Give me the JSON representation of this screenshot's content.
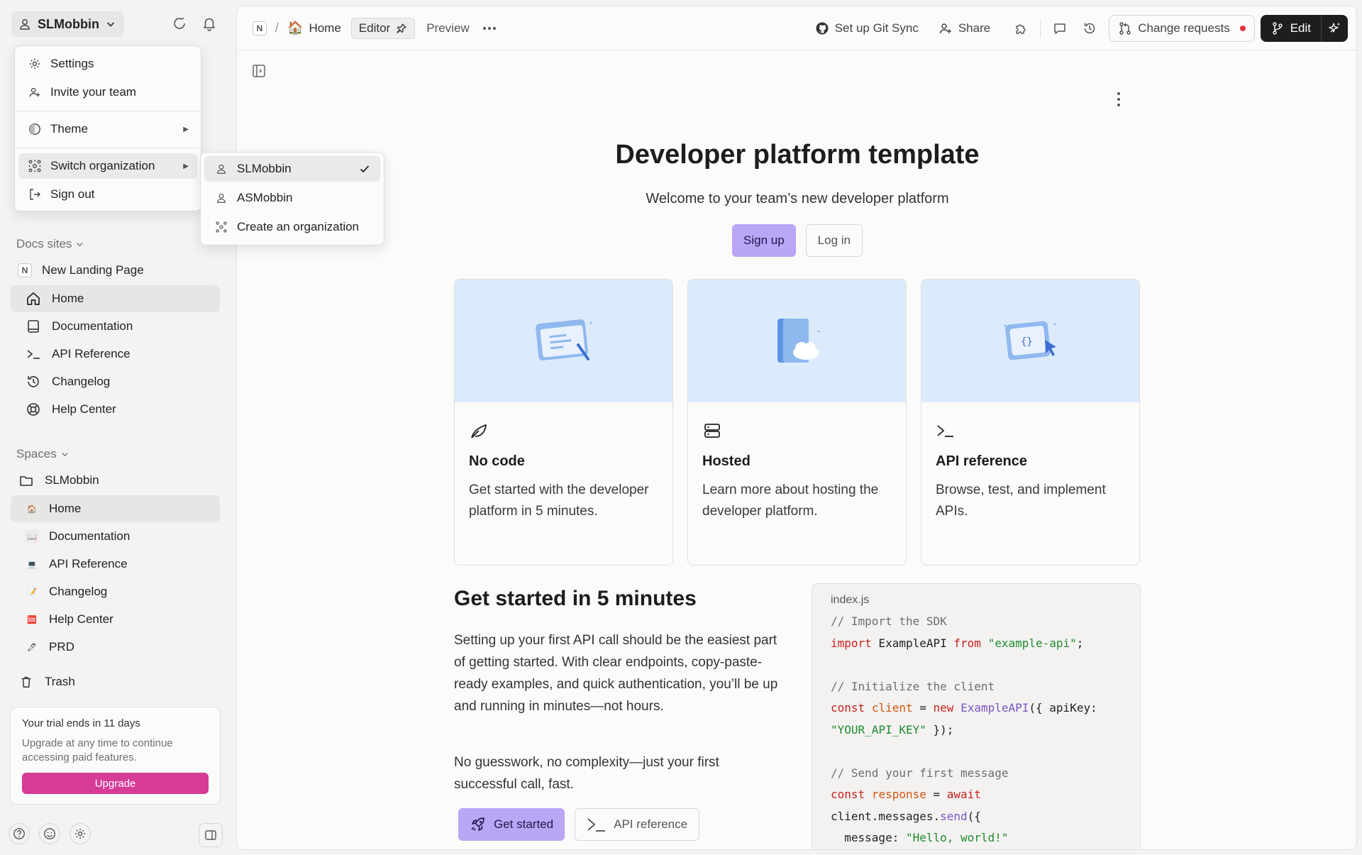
{
  "org": {
    "name": "SLMobbin"
  },
  "org_menu": {
    "settings": "Settings",
    "invite": "Invite your team",
    "theme": "Theme",
    "switch_org": "Switch organization",
    "sign_out": "Sign out"
  },
  "switch_submenu": {
    "items": [
      "SLMobbin",
      "ASMobbin",
      "Create an organization"
    ]
  },
  "sidebar": {
    "docs_sites_label": "Docs sites",
    "site_name": "New Landing Page",
    "site_items": [
      "Home",
      "Documentation",
      "API Reference",
      "Changelog",
      "Help Center"
    ],
    "spaces_label": "Spaces",
    "space_name": "SLMobbin",
    "space_items": [
      "Home",
      "Documentation",
      "API Reference",
      "Changelog",
      "Help Center",
      "PRD"
    ],
    "trash": "Trash"
  },
  "trial": {
    "title": "Your trial ends in 11 days",
    "subtitle": "Upgrade at any time to continue accessing paid features.",
    "button": "Upgrade"
  },
  "topbar": {
    "n_badge": "N",
    "separator": "/",
    "page": "Home",
    "editor_tab": "Editor",
    "preview_tab": "Preview",
    "git_sync": "Set up Git Sync",
    "share": "Share",
    "change_requests": "Change requests",
    "edit": "Edit"
  },
  "hero": {
    "title": "Developer platform template",
    "subtitle": "Welcome to your team’s new developer platform",
    "signup": "Sign up",
    "login": "Log in"
  },
  "cards": [
    {
      "title": "No code",
      "text": "Get started with the developer platform in 5 minutes."
    },
    {
      "title": "Hosted",
      "text": "Learn more about hosting the developer platform."
    },
    {
      "title": "API reference",
      "text": "Browse, test, and implement APIs."
    }
  ],
  "get_started": {
    "title": "Get started in 5 minutes",
    "p1": "Setting up your first API call should be the easiest part of getting started. With clear endpoints, copy-paste-ready examples, and quick authentication, you’ll be up and running in minutes—not hours.",
    "p2": "No guesswork, no complexity—just your first successful call, fast.",
    "btn_get_started": "Get started",
    "btn_api_ref": "API reference"
  },
  "code": {
    "filename": "index.js",
    "lines": [
      "// Import the SDK",
      "import ExampleAPI from \"example-api\";",
      "",
      "// Initialize the client",
      "const client = new ExampleAPI({ apiKey:",
      "\"YOUR_API_KEY\" });",
      "",
      "// Send your first message",
      "const response = await",
      "client.messages.send({",
      "  message: \"Hello, world!\""
    ]
  },
  "colors": {
    "accent_purple": "#b9a6f5",
    "upgrade_pink": "#d63b96",
    "card_hero_blue": "#dcebfb",
    "notification_red": "#e5343c"
  },
  "icons": {
    "settings": "gear-icon",
    "invite": "user-plus-icon",
    "theme": "theme-half-circle-icon",
    "switch": "org-cluster-icon",
    "sign_out": "sign-out-icon",
    "check": "check-icon"
  }
}
